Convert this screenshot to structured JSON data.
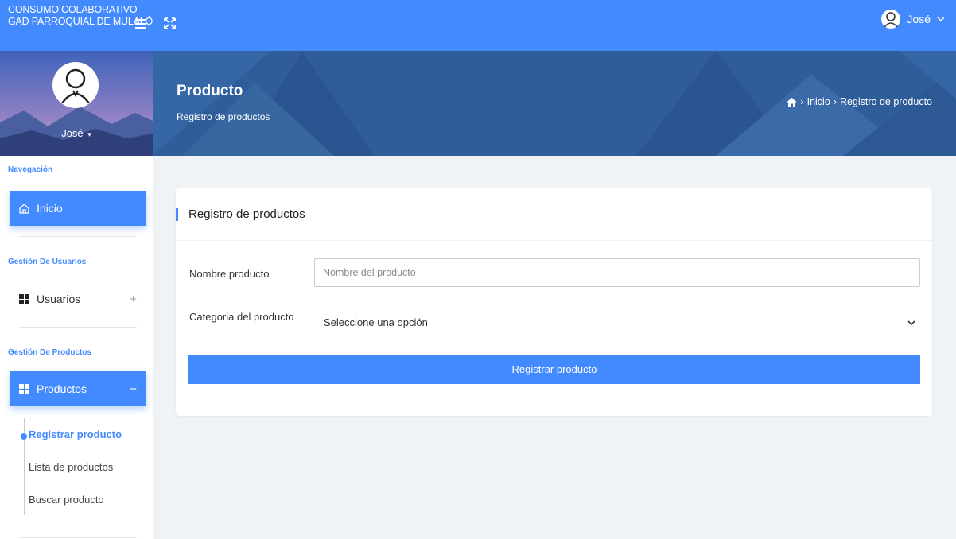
{
  "header": {
    "brand_line1": "CONSUMO COLABORATIVO",
    "brand_line2": "GAD PARROQUIAL DE MULALÓ",
    "user_name": "José"
  },
  "profile": {
    "name": "José"
  },
  "banner": {
    "title": "Producto",
    "subtitle": "Registro de productos",
    "breadcrumb": [
      "Inicio",
      "Registro de producto"
    ]
  },
  "sidebar": {
    "section_nav": "Navegación",
    "inicio": "Inicio",
    "section_users": "Gestión De Usuarios",
    "usuarios": "Usuarios",
    "usuarios_toggle": "+",
    "section_products": "Gestión De Productos",
    "productos": "Productos",
    "productos_toggle": "−",
    "sub_items": [
      "Registrar producto",
      "Lista de productos",
      "Buscar producto"
    ]
  },
  "form": {
    "card_title": "Registro de productos",
    "name_label": "Nombre producto",
    "name_placeholder": "Nombre del producto",
    "category_label": "Categoria del producto",
    "category_value": "Seleccione una opción",
    "submit_label": "Registrar producto"
  },
  "colors": {
    "accent": "#448aff",
    "banner": "#2f5d9a"
  },
  "icons": [
    "menu-icon",
    "expand-icon",
    "user-avatar-icon",
    "chevron-down-icon",
    "home-icon",
    "grid-icon"
  ]
}
